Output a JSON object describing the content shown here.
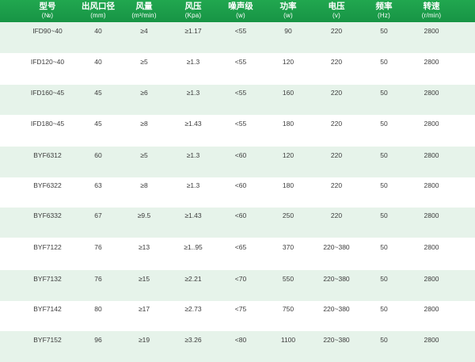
{
  "table": {
    "headers": [
      {
        "title": "型号",
        "unit": "(№)"
      },
      {
        "title": "出风口径",
        "unit": "(mm)"
      },
      {
        "title": "风量",
        "unit": "(m³/min)"
      },
      {
        "title": "风压",
        "unit": "(Kpa)"
      },
      {
        "title": "噪声级",
        "unit": "(w)"
      },
      {
        "title": "功率",
        "unit": "(w)"
      },
      {
        "title": "电压",
        "unit": "(v)"
      },
      {
        "title": "频率",
        "unit": "(Hz)"
      },
      {
        "title": "转速",
        "unit": "(r/min)"
      }
    ],
    "rows": [
      [
        "IFD90~40",
        "40",
        "≥4",
        "≥1.17",
        "<55",
        "90",
        "220",
        "50",
        "2800"
      ],
      [
        "IFD120~40",
        "40",
        "≥5",
        "≥1.3",
        "<55",
        "120",
        "220",
        "50",
        "2800"
      ],
      [
        "IFD160~45",
        "45",
        "≥6",
        "≥1.3",
        "<55",
        "160",
        "220",
        "50",
        "2800"
      ],
      [
        "IFD180~45",
        "45",
        "≥8",
        "≥1.43",
        "<55",
        "180",
        "220",
        "50",
        "2800"
      ],
      [
        "BYF6312",
        "60",
        "≥5",
        "≥1.3",
        "<60",
        "120",
        "220",
        "50",
        "2800"
      ],
      [
        "BYF6322",
        "63",
        "≥8",
        "≥1.3",
        "<60",
        "180",
        "220",
        "50",
        "2800"
      ],
      [
        "BYF6332",
        "67",
        "≥9.5",
        "≥1.43",
        "<60",
        "250",
        "220",
        "50",
        "2800"
      ],
      [
        "BYF7122",
        "76",
        "≥13",
        "≥1..95",
        "<65",
        "370",
        "220~380",
        "50",
        "2800"
      ],
      [
        "BYF7132",
        "76",
        "≥15",
        "≥2.21",
        "<70",
        "550",
        "220~380",
        "50",
        "2800"
      ],
      [
        "BYF7142",
        "80",
        "≥17",
        "≥2.73",
        "<75",
        "750",
        "220~380",
        "50",
        "2800"
      ],
      [
        "BYF7152",
        "96",
        "≥19",
        "≥3.26",
        "<80",
        "1100",
        "220~380",
        "50",
        "2800"
      ]
    ]
  },
  "colors": {
    "header_bg": "#1c9e4a",
    "row_shade": "#e6f3ea",
    "text": "#3c3c3c"
  }
}
